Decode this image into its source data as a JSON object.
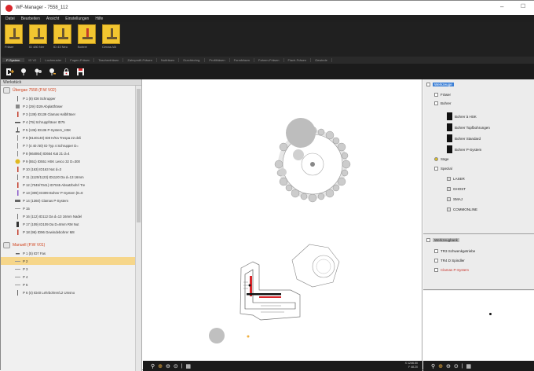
{
  "window": {
    "title": "WF-Manager - 7558_112"
  },
  "menu": [
    "Datei",
    "Bearbeiten",
    "Ansicht",
    "Einstellungen",
    "Hilfe"
  ],
  "tools": [
    {
      "caption": "Fräser",
      "color": "#f2c530"
    },
    {
      "caption": "ID 480 Ner",
      "color": "#f2c530"
    },
    {
      "caption": "ID 43 Neu",
      "color": "#f2c530"
    },
    {
      "caption": "Bohrer",
      "color": "#f2c530"
    },
    {
      "caption": "Cenas-VA",
      "color": "#f2c530"
    }
  ],
  "tabs": [
    "P-System",
    "ID V2",
    "Lochmuster",
    "Fugen-Fräsen",
    "Taschenfräsen",
    "Zahnprofil-Fräsen",
    "Nutfräsen",
    "Durchbohrg.",
    "Profilfräsen",
    "Formfräsen",
    "Fahren-Fräsen",
    "Flach-Fräsen",
    "Gewinde"
  ],
  "left": {
    "header": "Werkstück",
    "group1": "Übergae 7558 (P.W V02)",
    "rows1": [
      "P 1 (8) ID8 Schrupper",
      "P 2 (29) ID29 Abplattfräser",
      "P 3 (139) ID139 Clamas Halbfräser",
      "P 4 (79) Schruppfräser ID75",
      "P 5 (136) ID136 P-System_HSK",
      "P 6 (8140140) ID8 H/Ka Trespa 22 deli",
      "P 7 (4 40 /40) ID Typ 4 Schrupper D=",
      "P 8 (664864) ID664 Kat 21 d=4",
      "P 9 (551) ID551 HSK Lesco 32 D=300",
      "P 10 (163) ID163 Nut d=3",
      "P 11 (1120/1123) ID1120 Da d=13 16mm",
      "P 12 (7045/7041) ID7045 Absatzbohrl Tre",
      "P 13 (309) ID309 Bohrer P-System (8=8",
      "P 14 (1360) Clamas P-System",
      "P 15",
      "P 16 (112) ID112 Da d=13 16mm Nadel",
      "P 17 (109) ID109 Da D=8mm RM Nut",
      "P 18 (96) ID96 Gewindebohrer M8"
    ],
    "group2": "Manuell (P.W V01)",
    "rows2": [
      "P 1 (5) ID7 Fas",
      "P 2",
      "P 3",
      "P 4",
      "P 5",
      "P 6 (4) ID40 Lehrbohrer/L2 Umsno"
    ],
    "selected_row": "P 2"
  },
  "canvas": {
    "coords_line1": "X 1246.50",
    "coords_line2": "Y 48.20"
  },
  "right": {
    "root": "Werkzeuge",
    "nodes": [
      "Fräser",
      "Bohrer",
      "Bohrer à HSK",
      "Bohrer Topfbohrungen",
      "Bohrer Standard",
      "Bohrer P-System",
      "Säge",
      "Spezial",
      "LASER",
      "GHOST",
      "SMAJ",
      "COMMONLINE"
    ],
    "root2": "Werkzeugbank",
    "nodes2": [
      "TR3 Schwenkgetriebe",
      "TR4 D Spindler",
      "Clamas P-System"
    ]
  },
  "colors": {
    "accent": "#f2c530",
    "dark": "#1b1b1b",
    "highlight": "#3b7fd6",
    "selection": "#f6d68a",
    "red": "#c8322a"
  }
}
